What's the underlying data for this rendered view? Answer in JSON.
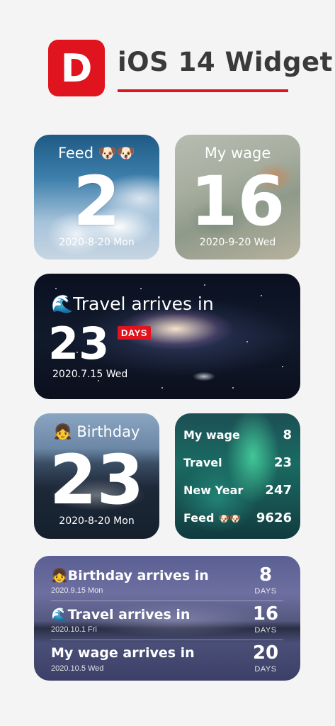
{
  "header": {
    "app_icon_letter": "D",
    "title": "iOS 14 Widget",
    "accent_color": "#e0141e"
  },
  "widget_feed": {
    "title": "Feed",
    "emoji": "🐶🐶",
    "number": "2",
    "date": "2020-8-20 Mon"
  },
  "widget_wage": {
    "title": "My wage",
    "number": "16",
    "date": "2020-9-20 Wed"
  },
  "widget_travel": {
    "emoji": "🌊",
    "title": "Travel arrives in",
    "number": "23",
    "badge": "DAYS",
    "date": "2020.7.15 Wed"
  },
  "widget_birthday": {
    "emoji": "👧",
    "title": "Birthday",
    "number": "23",
    "date": "2020-8-20 Mon"
  },
  "widget_list": {
    "rows": [
      {
        "name": "My wage",
        "emoji": "",
        "value": "8"
      },
      {
        "name": "Travel",
        "emoji": "",
        "value": "23"
      },
      {
        "name": "New Year",
        "emoji": "",
        "value": "247"
      },
      {
        "name": "Feed",
        "emoji": "🐶🐶",
        "value": "9626"
      }
    ]
  },
  "widget_arrivals": {
    "rows": [
      {
        "emoji": "👧",
        "title": "Birthday arrives in",
        "date": "2020.9.15 Mon",
        "days": "8",
        "unit": "DAYS"
      },
      {
        "emoji": "🌊",
        "title": "Travel arrives in",
        "date": "2020.10.1 Fri",
        "days": "16",
        "unit": "DAYS"
      },
      {
        "emoji": "",
        "title": "My wage arrives in",
        "date": "2020.10.5 Wed",
        "days": "20",
        "unit": "DAYS"
      }
    ]
  }
}
